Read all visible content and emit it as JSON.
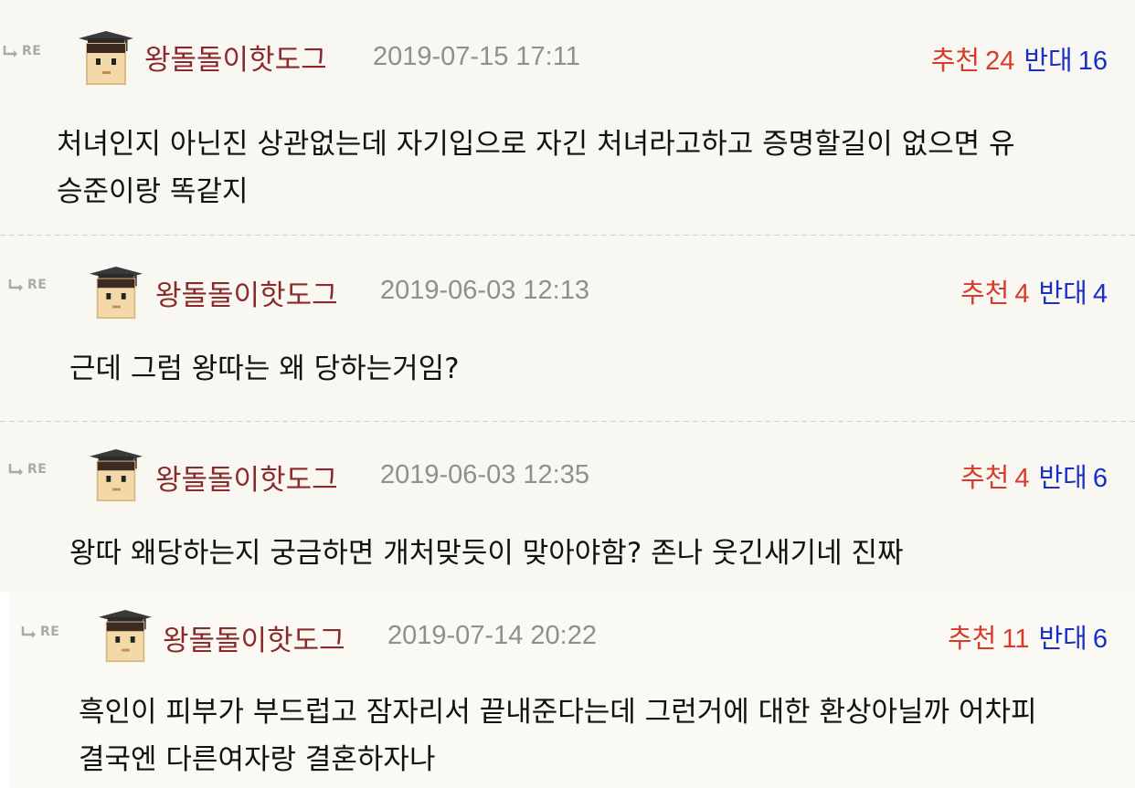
{
  "common": {
    "re_label": "RE",
    "up_label": "추천",
    "down_label": "반대"
  },
  "comments": [
    {
      "nickname": "왕돌돌이핫도그",
      "date": "2019-07-15 17:11",
      "up": "24",
      "down": "16",
      "lines": [
        "처녀인지 아닌진 상관없는데 자기입으로 자긴 처녀라고하고 증명할길이 없으면 유",
        "승준이랑 똑같지"
      ]
    },
    {
      "nickname": "왕돌돌이핫도그",
      "date": "2019-06-03 12:13",
      "up": "4",
      "down": "4",
      "lines": [
        "근데 그럼 왕따는 왜 당하는거임?"
      ]
    },
    {
      "nickname": "왕돌돌이핫도그",
      "date": "2019-06-03 12:35",
      "up": "4",
      "down": "6",
      "lines": [
        "왕따 왜당하는지 궁금하면 개처맞듯이 맞아야함? 존나 웃긴새기네 진짜"
      ]
    },
    {
      "nickname": "왕돌돌이핫도그",
      "date": "2019-07-14 20:22",
      "up": "11",
      "down": "6",
      "lines": [
        "흑인이 피부가 부드럽고 잠자리서 끝내준다는데 그런거에 대한 환상아닐까 어차피",
        "결국엔 다른여자랑 결혼하자나"
      ]
    }
  ],
  "icons": {
    "reply": "reply-arrow-icon",
    "avatar": "graduation-cap-avatar-icon"
  },
  "colors": {
    "nickname": "#8b2a2a",
    "date": "#8f8f8f",
    "recommend": "#d93a2b",
    "oppose": "#1b2fc4",
    "background": "#f9f7f1"
  }
}
